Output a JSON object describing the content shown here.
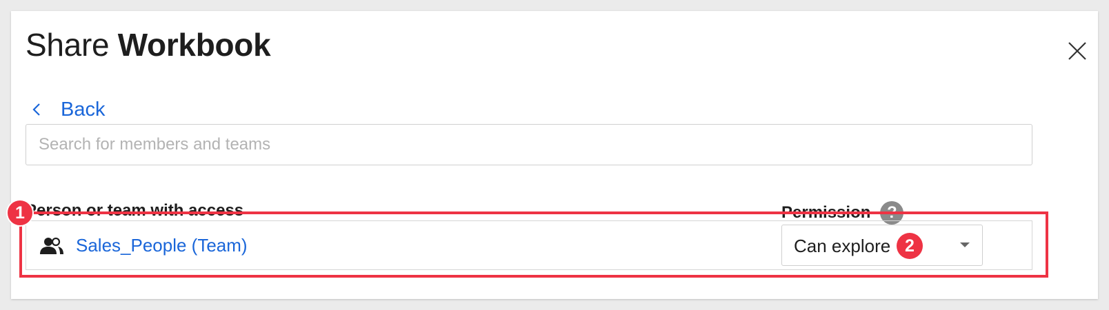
{
  "dialog": {
    "title_prefix": "Share",
    "title_bold": "Workbook",
    "close_icon": "close-icon"
  },
  "back": {
    "label": "Back",
    "icon": "chevron-left-icon"
  },
  "search": {
    "value": "",
    "placeholder": "Search for members and teams"
  },
  "table": {
    "headers": {
      "person": "Person or team with access",
      "permission": "Permission",
      "help_glyph": "?"
    },
    "rows": [
      {
        "icon": "team-icon",
        "name": "Sales_People (Team)",
        "permission": "Can explore"
      }
    ]
  },
  "annotations": {
    "marker_1": "1",
    "marker_2": "2",
    "highlight_color": "#ee3344"
  },
  "colors": {
    "link": "#1a66d9",
    "text": "#1e1e1e",
    "placeholder": "#b3b3b3"
  }
}
